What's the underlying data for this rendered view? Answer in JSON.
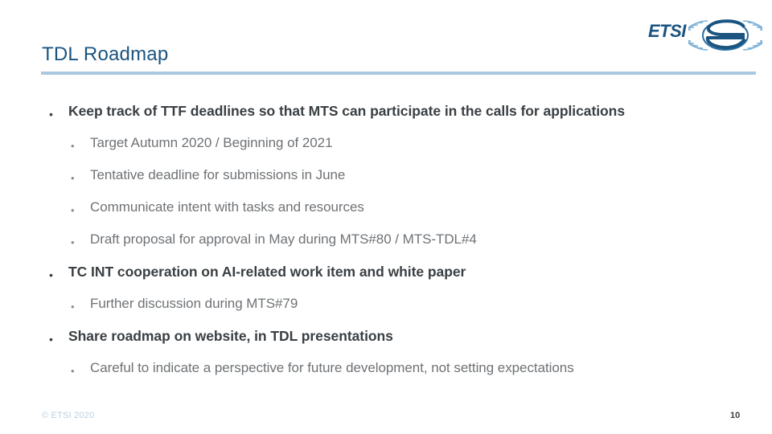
{
  "slide": {
    "title": "TDL Roadmap",
    "page_number": "10",
    "copyright": "© ETSI 2020",
    "logo": {
      "wordmark": "ETSI",
      "mark_name": "etsi-globe-icon"
    },
    "accent_color": "#1b5480",
    "rule_color": "#a9c8e2",
    "body_color": "#3a3f43",
    "sub_body_color": "#6e7276",
    "copyright_color": "#b9cfe2"
  },
  "bullets": [
    {
      "level": 1,
      "text": "Keep track of TTF deadlines so that MTS can participate in the calls for applications"
    },
    {
      "level": 2,
      "text": "Target Autumn 2020 / Beginning of 2021"
    },
    {
      "level": 2,
      "text": "Tentative deadline for submissions in June"
    },
    {
      "level": 2,
      "text": "Communicate intent with tasks and resources"
    },
    {
      "level": 2,
      "text": "Draft proposal for approval in May during MTS#80 / MTS-TDL#4"
    },
    {
      "level": 1,
      "text": "TC INT cooperation on AI-related work item and white paper"
    },
    {
      "level": 2,
      "text": "Further discussion during MTS#79"
    },
    {
      "level": 1,
      "text": "Share roadmap on website, in TDL presentations"
    },
    {
      "level": 2,
      "text": "Careful to indicate a perspective for future development, not setting expectations"
    }
  ],
  "bullet_glyph": "•"
}
